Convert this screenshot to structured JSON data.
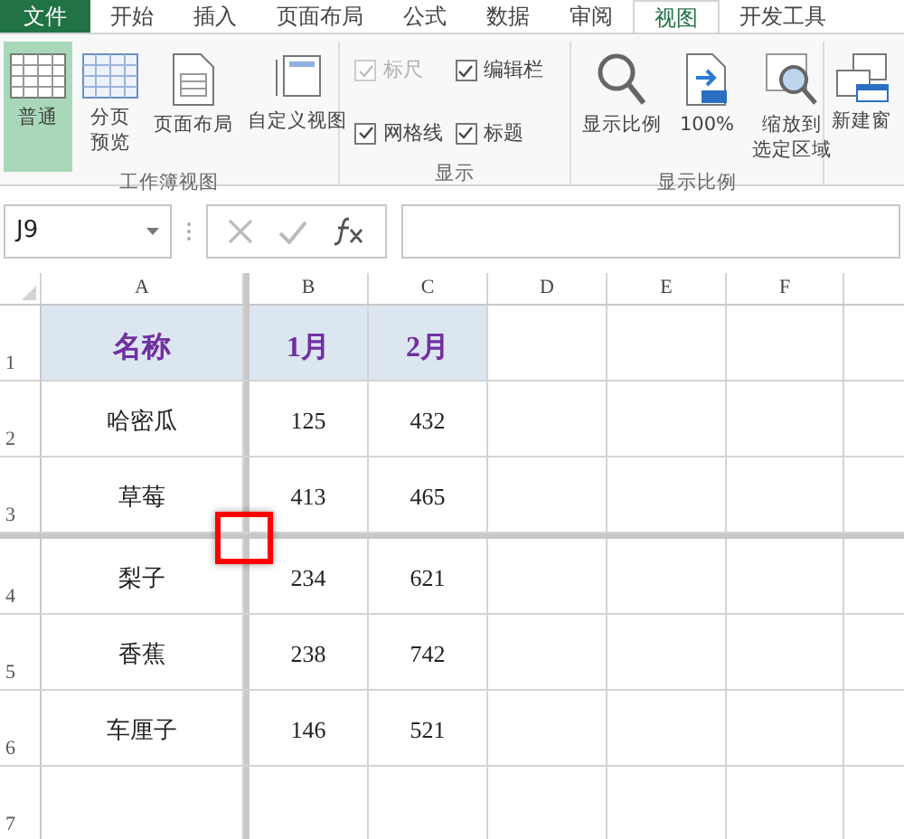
{
  "file_tab": "文件",
  "tabs": [
    {
      "label": "开始",
      "selected": false
    },
    {
      "label": "插入",
      "selected": false
    },
    {
      "label": "页面布局",
      "selected": false
    },
    {
      "label": "公式",
      "selected": false
    },
    {
      "label": "数据",
      "selected": false
    },
    {
      "label": "审阅",
      "selected": false
    },
    {
      "label": "视图",
      "selected": true
    },
    {
      "label": "开发工具",
      "selected": false
    }
  ],
  "ribbon": {
    "views": {
      "title": "工作簿视图",
      "buttons": [
        {
          "kind": "normal",
          "label": "普通",
          "selected": true
        },
        {
          "kind": "pagebreak",
          "label_lines": [
            "分页",
            "预览"
          ],
          "selected": false
        },
        {
          "kind": "pagelayout",
          "label": "页面布局",
          "selected": false
        },
        {
          "kind": "custom",
          "label": "自定义视图",
          "selected": false
        }
      ]
    },
    "show": {
      "title": "显示",
      "checkboxes": [
        {
          "label": "标尺",
          "checked": true,
          "disabled": true
        },
        {
          "label": "网格线",
          "checked": true,
          "disabled": false
        },
        {
          "label": "编辑栏",
          "checked": true,
          "disabled": false
        },
        {
          "label": "标题",
          "checked": true,
          "disabled": false
        }
      ]
    },
    "zoom": {
      "title": "显示比例",
      "buttons": [
        {
          "kind": "zoom",
          "label": "显示比例"
        },
        {
          "kind": "hundred",
          "label": "100%"
        },
        {
          "kind": "selection",
          "label_lines": [
            "缩放到",
            "选定区域"
          ]
        }
      ]
    },
    "new_window": {
      "label": "新建窗"
    }
  },
  "formula_bar": {
    "name_box": "J9"
  },
  "columns": [
    "A",
    "B",
    "C",
    "D",
    "E",
    "F"
  ],
  "rows": [
    {
      "number": "1",
      "cells": [
        "名称",
        "1月",
        "2月"
      ],
      "header": true
    },
    {
      "number": "2",
      "cells": [
        "哈密瓜",
        "125",
        "432"
      ],
      "header": false
    },
    {
      "number": "3",
      "cells": [
        "草莓",
        "413",
        "465"
      ],
      "header": false
    },
    {
      "number": "4",
      "cells": [
        "梨子",
        "234",
        "621"
      ],
      "header": false
    },
    {
      "number": "5",
      "cells": [
        "香蕉",
        "238",
        "742"
      ],
      "header": false
    },
    {
      "number": "6",
      "cells": [
        "车厘子",
        "146",
        "521"
      ],
      "header": false
    },
    {
      "number": "7",
      "cells": [],
      "header": false
    }
  ]
}
